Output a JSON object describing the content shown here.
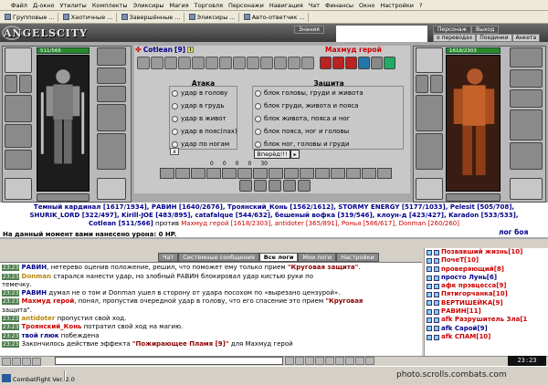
{
  "menubar": {
    "items": [
      "Файл",
      "Д-окно",
      "Утилиты",
      "Комплекты",
      "Эликсиры",
      "Магия",
      "Торговля",
      "Персонажи",
      "Навигация",
      "Чат",
      "Финансы",
      "Окно",
      "Настройки",
      "?"
    ]
  },
  "toolbar": {
    "tabs": [
      "Групповые ...",
      "Хаотичные ...",
      "Завершённые ...",
      "Эликсиры ...",
      "Авто-ответчик ..."
    ]
  },
  "header": {
    "logo": "ANGELSCITY",
    "nav_top": [
      "Знания",
      "Персонаж",
      "Выход"
    ],
    "nav_bottom": [
      "о переводах",
      "Поединки",
      "Анкета"
    ]
  },
  "left_char": {
    "name": "Cotlean",
    "level": "[9]",
    "hp": "511/566"
  },
  "right_char": {
    "name": "Махмуд герой",
    "hp": "1618/2303",
    "level_label": "x4"
  },
  "combat": {
    "attack_header": "Атака",
    "defense_header": "Защита",
    "attack_options": [
      "удар в голову",
      "удар в грудь",
      "удар в живот",
      "удар в пояс(пах)",
      "удар по ногам"
    ],
    "defense_options": [
      "блок головы, груди и живота",
      "блок груди, живота и пояса",
      "блок живота, пояса и ног",
      "блок пояса, ног и головы",
      "блок ног, головы и груди"
    ],
    "go_button": "Вперёд!!!",
    "left_check": "x",
    "stats": [
      "0",
      "0",
      "0",
      "0",
      "30"
    ]
  },
  "players": {
    "line1": "Темный кардинал [1617/1934], РАВИН [1640/2676], Троянский_Конь [1562/1612], STORMY ENERGY [5177/1033], Pelesit [505/708],",
    "line2": "SHURIK_LORD [322/497], Kirill-JOE [483/895], catafalque [544/632], бешеный вофка [319/546], клоун-д [423/427], Karadon [533/533],",
    "line3_a": "Cotlean [511/566]",
    "line3_against": "против",
    "line3_b": "Махмуд герой [1618/2303], antidoter [365/891], Ронья [586/617], Donman [260/260]"
  },
  "damage_line": "На данный момент вами нанесено урона: 0 HP.",
  "battle_log_link": "лог боя",
  "chat_tabs": [
    "Чат",
    "Системные сообщения",
    "Все логи",
    "Мои логи",
    "Настройки"
  ],
  "chat": [
    {
      "t": "23:23",
      "a": "РАВИН",
      "b": ", нетерево оценив положение, решил, что поможет ему только прием ",
      "c": "\"Круговая защита\"",
      "d": "."
    },
    {
      "t": "23:23",
      "a": "Donman",
      "b": " старался нанести удар, но злобный РАВИН блокировал удар кистью руки по",
      "c": "",
      "d": ""
    },
    {
      "t": "",
      "a": "",
      "b": "темечку.",
      "c": "",
      "d": ""
    },
    {
      "t": "23:23",
      "a": "РАВИН",
      "b": " думал не о том и Donman ушел в сторону от удара посохом по «вырезано цензурой».",
      "c": "",
      "d": ""
    },
    {
      "t": "23:23",
      "a": "Махмуд герой",
      "b": ", понял, пропустив очередной удар в голову, что его спасение это прием ",
      "c": "\"Круговая",
      "d": ""
    },
    {
      "t": "",
      "a": "",
      "b": "защита\".",
      "c": "",
      "d": ""
    },
    {
      "t": "23:23",
      "a": "antidoter",
      "b": " пропустил свой ход.",
      "c": "",
      "d": ""
    },
    {
      "t": "23:23",
      "a": "Троянский_Конь",
      "b": " потратил свой ход на магию.",
      "c": "",
      "d": ""
    },
    {
      "t": "23:23",
      "a": "твой глюк",
      "b": " побеждена",
      "c": "",
      "d": ""
    },
    {
      "t": "23:23",
      "a": "",
      "b": "Закончилось действие эффекта ",
      "c": "\"Пожирающее Пламя [9]\"",
      "d": " для Махмуд герой"
    }
  ],
  "userlist": [
    {
      "n": "Позвавший жизнь[10]",
      "c": "red"
    },
    {
      "n": "ПочеТ[10]",
      "c": "red"
    },
    {
      "n": "проверяющий[8]",
      "c": "red"
    },
    {
      "n": "просто Лунь[6]",
      "c": "blu"
    },
    {
      "n": "афк прэвцесса[9]",
      "c": "red"
    },
    {
      "n": "Пятигорчанка[10]",
      "c": "red"
    },
    {
      "n": "ВЕРТИШЕЙКА[9]",
      "c": "red"
    },
    {
      "n": "РАВИН[11]",
      "c": "red"
    },
    {
      "n": "afk Разрушитель Зла[1",
      "c": "red"
    },
    {
      "n": "afk Сарой[9]",
      "c": "blu"
    },
    {
      "n": "afk СПАМ[10]",
      "c": "red"
    }
  ],
  "clock": "23:23",
  "statusbar": {
    "text": "CombatFight Ver. 2.0"
  },
  "watermark": "photo.scrolls.combats.com"
}
